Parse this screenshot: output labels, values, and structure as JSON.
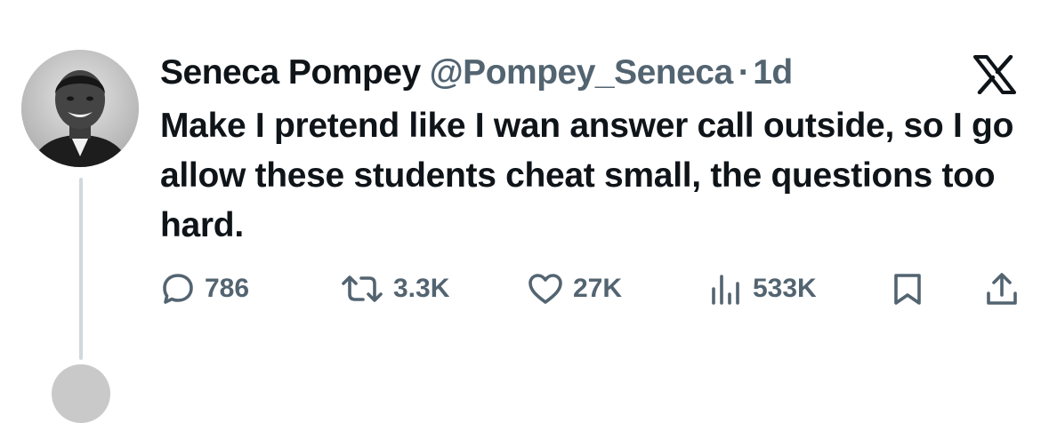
{
  "tweet": {
    "author_name": "Seneca Pompey",
    "handle": "@Pompey_Seneca",
    "separator": "·",
    "time": "1d",
    "text": "Make I pretend like I wan answer call outside, so I go allow these students cheat small, the questions too hard."
  },
  "actions": {
    "replies": "786",
    "reposts": "3.3K",
    "likes": "27K",
    "views": "533K"
  },
  "icons": {
    "reply": "reply-icon",
    "repost": "repost-icon",
    "like": "heart-icon",
    "views": "views-icon",
    "bookmark": "bookmark-icon",
    "share": "share-icon",
    "brand": "x-logo-icon"
  },
  "colors": {
    "text": "#0f1419",
    "secondary": "#536471",
    "thread_line": "#cfd9de"
  }
}
